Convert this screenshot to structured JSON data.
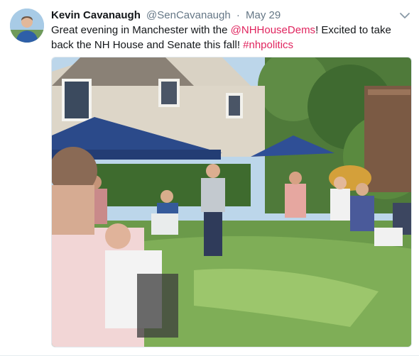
{
  "tweet": {
    "author_name": "Kevin Cavanaugh",
    "handle": "@SenCavanaugh",
    "separator": "·",
    "date": "May 29",
    "text_part1": "Great evening in Manchester with the ",
    "mention": "@NHHouseDems",
    "text_part2": "! Excited to take back the NH House and Senate this fall! ",
    "hashtag": "#nhpolitics"
  },
  "icons": {
    "caret": "chevron-down-icon"
  },
  "colors": {
    "link": "#e0245e",
    "secondary_text": "#657786",
    "primary_text": "#14171a"
  }
}
